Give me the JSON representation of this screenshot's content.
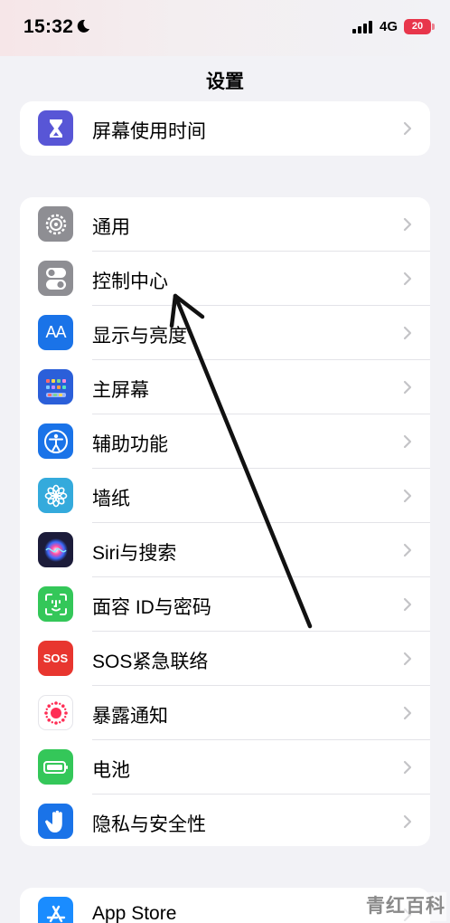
{
  "status_bar": {
    "time": "15:32",
    "network": "4G",
    "battery": "20"
  },
  "nav": {
    "title": "设置"
  },
  "groups": [
    {
      "items": [
        {
          "label": "屏幕使用时间",
          "icon": "hourglass-icon",
          "color": "#5856d6"
        }
      ]
    },
    {
      "items": [
        {
          "label": "通用",
          "icon": "gear-icon",
          "color": "#8e8e93"
        },
        {
          "label": "控制中心",
          "icon": "toggle-icon",
          "color": "#8e8e93"
        },
        {
          "label": "显示与亮度",
          "icon": "text-size-icon",
          "color": "#1a73e8"
        },
        {
          "label": "主屏幕",
          "icon": "home-grid-icon",
          "color": "#2b5fd9"
        },
        {
          "label": "辅助功能",
          "icon": "accessibility-icon",
          "color": "#1a73e8"
        },
        {
          "label": "墙纸",
          "icon": "flower-icon",
          "color": "#34aadc"
        },
        {
          "label": "Siri与搜索",
          "icon": "siri-icon",
          "color": "#1c1c3a"
        },
        {
          "label": "面容 ID与密码",
          "icon": "face-id-icon",
          "color": "#34c759"
        },
        {
          "label": "SOS紧急联络",
          "icon": "sos-icon",
          "color": "#e8362f"
        },
        {
          "label": "暴露通知",
          "icon": "exposure-icon",
          "color": "#ffffff"
        },
        {
          "label": "电池",
          "icon": "battery-icon",
          "color": "#34c759"
        },
        {
          "label": "隐私与安全性",
          "icon": "hand-icon",
          "color": "#1a73e8"
        }
      ]
    },
    {
      "items": [
        {
          "label": "App Store",
          "icon": "app-store-icon",
          "color": "#1a8cff"
        }
      ]
    }
  ],
  "icon_text": {
    "text_size": "AA",
    "sos": "SOS"
  },
  "watermark": "青红百科",
  "annotation": {
    "type": "arrow",
    "color": "#111111",
    "points_to": "控制中心"
  }
}
